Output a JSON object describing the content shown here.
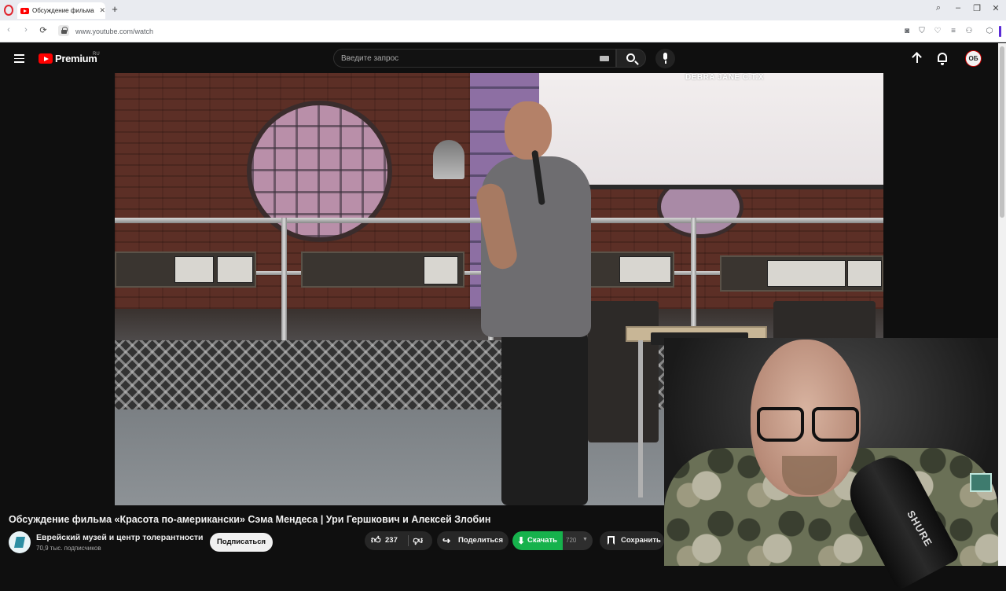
{
  "browser": {
    "tab_title": "Обсуждение фильма «Красота по-американски»",
    "tab_close": "✕",
    "new_tab": "+",
    "url": "www.youtube.com/watch",
    "back": "‹",
    "forward": "›",
    "reload": "⟳"
  },
  "header": {
    "logo_text": "Premium",
    "region": "RU",
    "search_placeholder": "Введите запрос",
    "avatar_initials": "ОБ"
  },
  "video": {
    "screen_text": "DEBRA JANE C.T.X",
    "cam_brand": "SHURE"
  },
  "info": {
    "title": "Обсуждение фильма «Красота по-американски» Сэма Мендеса | Ури Гершкович и Алексей Злобин",
    "channel_name": "Еврейский музей и центр толерантности",
    "subscribers": "70,9 тыс. подписчиков",
    "subscribe_label": "Подписаться",
    "like_count": "237",
    "share_label": "Поделиться",
    "download_label": "Скачать",
    "download_quality": "720",
    "save_label": "Сохранить"
  }
}
